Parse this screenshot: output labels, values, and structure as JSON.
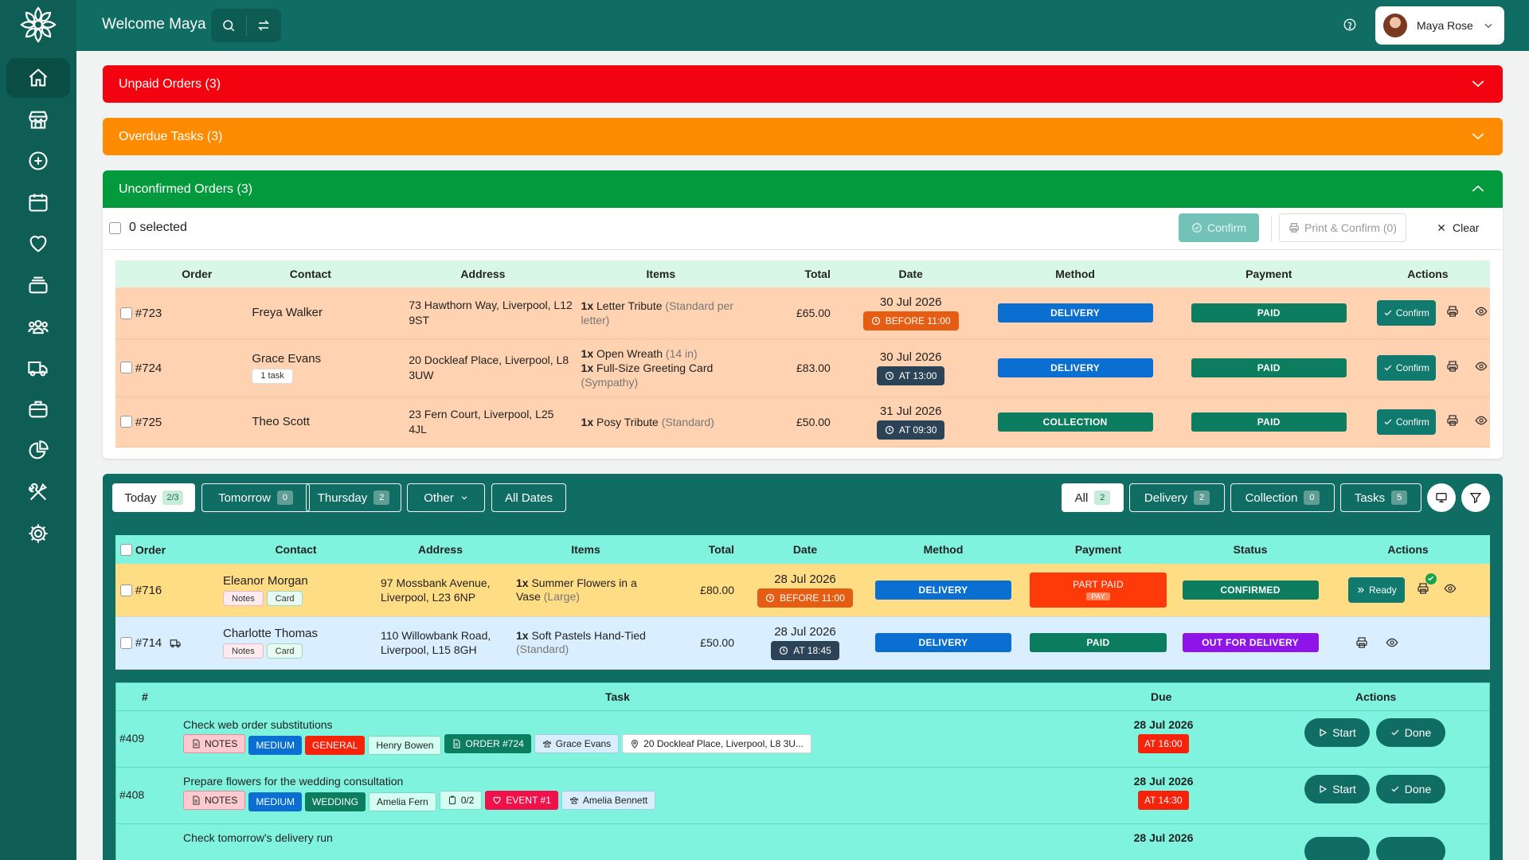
{
  "app": {
    "welcome": "Welcome Maya",
    "user_name": "Maya Rose"
  },
  "sidebar": {
    "items": [
      "home-icon",
      "store-icon",
      "plus-circle-icon",
      "calendar-icon",
      "heart-icon",
      "layers-icon",
      "people-icon",
      "truck-icon",
      "briefcase-icon",
      "pie-chart-icon",
      "tools-icon",
      "settings-icon"
    ]
  },
  "accordions": {
    "unpaid": "Unpaid Orders (3)",
    "overdue": "Overdue Tasks (3)",
    "unconfirmed": "Unconfirmed Orders (3)"
  },
  "colors": {
    "unpaid": "#f2030f",
    "overdue": "#ff8c00",
    "unconfirmed": "#029a3c",
    "delivery": "#0a6fd1",
    "paid": "#0c7e5f",
    "collection": "#0c7e5f",
    "before": "#e55d12",
    "at": "#2c4357",
    "part_paid": "#ff3a0a",
    "confirmed": "#0c7e5f",
    "out_for_delivery": "#8f14e8",
    "high_task": "#f6230a"
  },
  "unconfirmed_panel": {
    "selected": "0 selected",
    "confirm": "Confirm",
    "print_confirm": "Print & Confirm (0)",
    "clear": "Clear",
    "columns": [
      "Order",
      "Contact",
      "Address",
      "Items",
      "Total",
      "Date",
      "Method",
      "Payment",
      "Actions"
    ],
    "rows": [
      {
        "order": "#723",
        "contact": "Freya Walker",
        "tag": "",
        "address": "73 Hawthorn Way, Liverpool, L12 9ST",
        "items": [
          {
            "qty": "1x",
            "name": "Letter Tribute",
            "variant": "(Standard per letter)"
          }
        ],
        "total": "£65.00",
        "date": "30 Jul 2026",
        "time": "BEFORE 11:00",
        "time_type": "before",
        "method": "DELIVERY",
        "payment": "PAID",
        "action": "Confirm"
      },
      {
        "order": "#724",
        "contact": "Grace Evans",
        "tag": "1 task",
        "address": "20 Dockleaf Place, Liverpool, L8 3UW",
        "items": [
          {
            "qty": "1x",
            "name": "Open Wreath",
            "variant": "(14 in)"
          },
          {
            "qty": "1x",
            "name": "Full-Size Greeting Card",
            "variant": "(Sympathy)"
          }
        ],
        "total": "£83.00",
        "date": "30 Jul 2026",
        "time": "AT 13:00",
        "time_type": "at",
        "method": "DELIVERY",
        "payment": "PAID",
        "action": "Confirm"
      },
      {
        "order": "#725",
        "contact": "Theo Scott",
        "tag": "",
        "address": "23 Fern Court, Liverpool, L25 4JL",
        "items": [
          {
            "qty": "1x",
            "name": "Posy Tribute",
            "variant": "(Standard)"
          }
        ],
        "total": "£50.00",
        "date": "31 Jul 2026",
        "time": "AT 09:30",
        "time_type": "at",
        "method": "COLLECTION",
        "payment": "PAID",
        "action": "Confirm"
      }
    ]
  },
  "schedule": {
    "day_filters": [
      {
        "label": "Today",
        "count": "2/3"
      },
      {
        "label": "Tomorrow",
        "count": "0"
      },
      {
        "label": "Thursday",
        "count": "2"
      },
      {
        "label": "Other",
        "count": ""
      },
      {
        "label": "All Dates",
        "count": ""
      }
    ],
    "type_filters": [
      {
        "label": "All",
        "count": "2"
      },
      {
        "label": "Delivery",
        "count": "2"
      },
      {
        "label": "Collection",
        "count": "0"
      },
      {
        "label": "Tasks",
        "count": "5"
      }
    ],
    "columns": [
      "Order",
      "Contact",
      "Address",
      "Items",
      "Total",
      "Date",
      "Method",
      "Payment",
      "Status",
      "Actions"
    ],
    "rows": [
      {
        "order": "#716",
        "contact": "Eleanor Morgan",
        "tags": [
          "Notes",
          "Card"
        ],
        "address": "97 Mossbank Avenue, Liverpool, L23 6NP",
        "item_qty": "1x",
        "item_name": "Summer Flowers in a Vase",
        "item_variant": "(Large)",
        "total": "£80.00",
        "date": "28 Jul 2026",
        "time": "BEFORE 11:00",
        "method": "DELIVERY",
        "payment": "PART PAID",
        "payment_sub": "PAY",
        "status": "CONFIRMED",
        "action": "Ready"
      },
      {
        "order": "#714",
        "contact": "Charlotte Thomas",
        "tags": [
          "Notes",
          "Card"
        ],
        "address": "110 Willowbank Road, Liverpool, L15 8GH",
        "item_qty": "1x",
        "item_name": "Soft Pastels Hand-Tied",
        "item_variant": "(Standard)",
        "total": "£50.00",
        "date": "28 Jul 2026",
        "time": "AT 18:45",
        "method": "DELIVERY",
        "payment": "PAID",
        "status": "OUT FOR DELIVERY"
      }
    ]
  },
  "tasks": {
    "columns": [
      "#",
      "Task",
      "Due",
      "Actions"
    ],
    "start": "Start",
    "done": "Done",
    "rows": [
      {
        "id": "#409",
        "title": "Check web order substitutions",
        "tags": [
          "NOTES",
          "MEDIUM",
          "GENERAL",
          "Henry Bowen",
          "ORDER #724",
          "Grace Evans",
          "20 Dockleaf Place, Liverpool, L8 3U..."
        ],
        "due": "28 Jul 2026",
        "time": "AT 16:00"
      },
      {
        "id": "#408",
        "title": "Prepare flowers for the wedding consultation",
        "tags": [
          "NOTES",
          "MEDIUM",
          "WEDDING",
          "Amelia Fern",
          "0/2",
          "EVENT #1",
          "Amelia Bennett"
        ],
        "due": "28 Jul 2026",
        "time": "AT 14:30"
      },
      {
        "id": "",
        "title": "Check tomorrow's delivery run",
        "tags": [],
        "due": "28 Jul 2026",
        "time": ""
      }
    ]
  }
}
